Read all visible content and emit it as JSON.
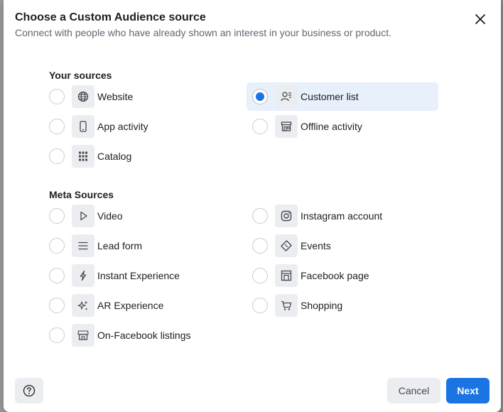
{
  "dialog": {
    "title": "Choose a Custom Audience source",
    "subtitle": "Connect with people who have already shown an interest in your business or product."
  },
  "your_sources": {
    "heading": "Your sources",
    "options": [
      {
        "label": "Website",
        "icon": "globe-icon",
        "selected": false
      },
      {
        "label": "Customer list",
        "icon": "customer-list-icon",
        "selected": true
      },
      {
        "label": "App activity",
        "icon": "mobile-icon",
        "selected": false
      },
      {
        "label": "Offline activity",
        "icon": "store-icon",
        "selected": false
      },
      {
        "label": "Catalog",
        "icon": "grid-icon",
        "selected": false
      }
    ]
  },
  "meta_sources": {
    "heading": "Meta Sources",
    "options": [
      {
        "label": "Video",
        "icon": "play-icon",
        "selected": false
      },
      {
        "label": "Instagram account",
        "icon": "instagram-icon",
        "selected": false
      },
      {
        "label": "Lead form",
        "icon": "lines-icon",
        "selected": false
      },
      {
        "label": "Events",
        "icon": "ticket-icon",
        "selected": false
      },
      {
        "label": "Instant Experience",
        "icon": "lightning-icon",
        "selected": false
      },
      {
        "label": "Facebook page",
        "icon": "page-icon",
        "selected": false
      },
      {
        "label": "AR Experience",
        "icon": "sparkle-icon",
        "selected": false
      },
      {
        "label": "Shopping",
        "icon": "cart-icon",
        "selected": false
      },
      {
        "label": "On-Facebook listings",
        "icon": "storefront-icon",
        "selected": false
      }
    ]
  },
  "footer": {
    "cancel_label": "Cancel",
    "next_label": "Next"
  },
  "colors": {
    "accent": "#1b74e4",
    "selected_bg": "#e7f0fb"
  }
}
